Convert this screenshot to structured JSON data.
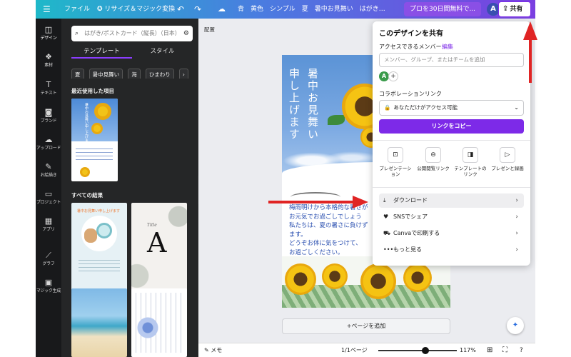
{
  "topbar": {
    "menu_icon": "☰",
    "file": "ファイル",
    "resize": "リサイズ＆マジック変換",
    "undo_icon": "↶",
    "redo_icon": "↷",
    "cloud_icon": "☁",
    "doc_title": "青　黄色　シンプル　夏　暑中お見舞い　はがき…",
    "pro_cta": "プロを30日間無料で...",
    "avatar_letter": "A",
    "plus": "+",
    "stats_icon": "▥",
    "share_icon": "⇪",
    "share_label": "共有"
  },
  "rail": {
    "items": [
      {
        "icon": "◫",
        "label": "デザイン"
      },
      {
        "icon": "❖",
        "label": "素材"
      },
      {
        "icon": "T",
        "label": "テキスト"
      },
      {
        "icon": "◙",
        "label": "ブランド"
      },
      {
        "icon": "☁",
        "label": "アップロード"
      },
      {
        "icon": "✎",
        "label": "お絵描き"
      },
      {
        "icon": "▭",
        "label": "プロジェクト"
      },
      {
        "icon": "▦",
        "label": "アプリ"
      },
      {
        "icon": "⟋",
        "label": "グラフ"
      },
      {
        "icon": "▣",
        "label": "マジック生成"
      }
    ]
  },
  "panel": {
    "search_placeholder": "はがき/ポストカード（縦長）（日本）",
    "search_icon": "⌕",
    "filter_icon": "⚙",
    "tabs": [
      "テンプレート",
      "スタイル"
    ],
    "chips": [
      "夏",
      "暑中見舞い",
      "海",
      "ひまわり",
      "›"
    ],
    "recent_title": "最近使用した項目",
    "all_results_title": "すべての結果",
    "thumb_a_text": "暑中お見舞い申し上げます",
    "thumb_b_title": "Title",
    "thumb_b_letter": "A",
    "thumb_recent_text": "暑中お見舞い申し上げます",
    "toggle_icon": "‹"
  },
  "canvas": {
    "arrange_label": "配置",
    "vertical_1": "暑中お見舞い",
    "vertical_2": "申し上げます",
    "body_text": "梅雨明けから本格的な暑さが\nお元気でお過ごしでしょう\n私たちは、夏の暑さに負けず\nます。\nどうぞお体に気をつけて、\nお過ごしください。",
    "add_page": "+ページを追加",
    "magic_icon": "✦"
  },
  "bottombar": {
    "notes_icon": "✎",
    "notes": "メモ",
    "page_indicator": "1/1ページ",
    "zoom_level": "117%",
    "zoom_fraction": 0.6,
    "grid_icon": "⊞",
    "fullscreen_icon": "⛶",
    "help_icon": "?"
  },
  "share": {
    "title": "このデザインを共有",
    "access_label": "アクセスできるメンバー",
    "edit_link": "編集",
    "input_placeholder": "メンバー、グループ、またはチームを追加",
    "avatar_letter": "A",
    "avatar_plus": "+",
    "collab_label": "コラボレーションリンク",
    "lock_icon": "🔒",
    "access_value": "あなただけがアクセス可能",
    "chevron_down": "⌄",
    "copy_link": "リンクをコピー",
    "options": [
      {
        "icon": "⊡",
        "label": "プレゼンテーション"
      },
      {
        "icon": "⊖",
        "label": "公開閲覧リンク"
      },
      {
        "icon": "◨",
        "label": "テンプレートのリンク"
      },
      {
        "icon": "▷",
        "label": "プレゼンと録画"
      }
    ],
    "rows": [
      {
        "icon": "⤓",
        "label": "ダウンロード"
      },
      {
        "icon": "♥",
        "label": "SNSでシェア"
      },
      {
        "icon": "⛟",
        "label": "Canvaで印刷する"
      },
      {
        "icon": "•••",
        "label": "もっと見る"
      }
    ],
    "chevron_right": "›"
  }
}
